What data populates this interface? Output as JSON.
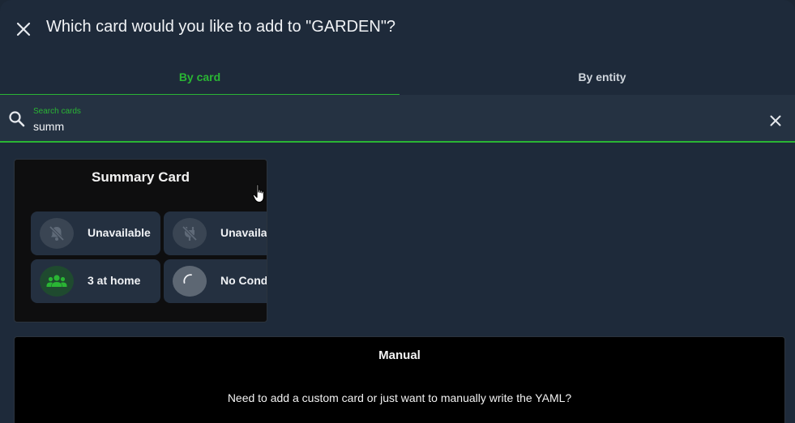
{
  "dialog": {
    "title": "Which card would you like to add to \"GARDEN\"?",
    "close_icon": "close-icon"
  },
  "tabs": [
    {
      "label": "By card",
      "active": true
    },
    {
      "label": "By entity",
      "active": false
    }
  ],
  "search": {
    "label": "Search cards",
    "value": "summ",
    "icon": "search-icon",
    "clear_icon": "close-icon"
  },
  "cards": {
    "summary": {
      "title": "Summary Card",
      "tiles": [
        {
          "label": "Unavailable",
          "icon": "bell-off-icon"
        },
        {
          "label": "Unavailable",
          "icon": "power-plug-off-icon"
        },
        {
          "label": "3 at home",
          "icon": "account-group-icon"
        },
        {
          "label": "No Conditions",
          "icon": "loading-icon"
        }
      ]
    },
    "manual": {
      "title": "Manual",
      "description": "Need to add a custom card or just want to manually write the YAML?"
    }
  },
  "colors": {
    "accent": "#2ab534",
    "background": "#1e2a3a",
    "search_bg": "#253242",
    "tile_bg": "#243040",
    "card_bg": "#0e0e0f"
  }
}
